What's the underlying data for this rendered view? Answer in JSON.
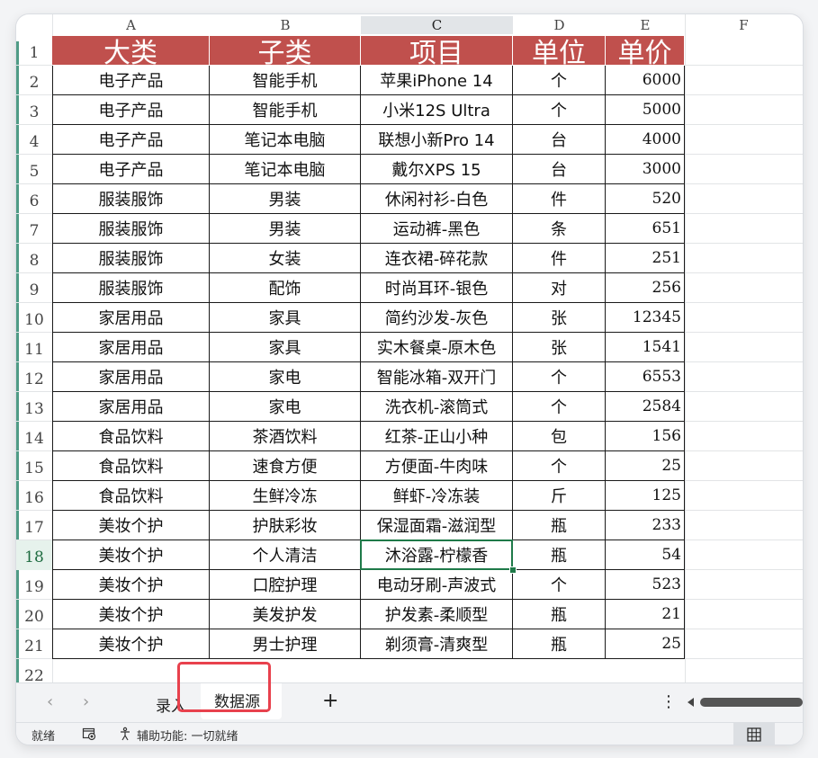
{
  "columns": [
    "A",
    "B",
    "C",
    "D",
    "E",
    "F"
  ],
  "row_numbers": [
    "1",
    "2",
    "3",
    "4",
    "5",
    "6",
    "7",
    "8",
    "9",
    "10",
    "11",
    "12",
    "13",
    "14",
    "15",
    "16",
    "17",
    "18",
    "19",
    "20",
    "21",
    "22"
  ],
  "header": [
    "大类",
    "子类",
    "项目",
    "单位",
    "单价"
  ],
  "rows": [
    [
      "电子产品",
      "智能手机",
      "苹果iPhone 14",
      "个",
      "6000"
    ],
    [
      "电子产品",
      "智能手机",
      "小米12S Ultra",
      "个",
      "5000"
    ],
    [
      "电子产品",
      "笔记本电脑",
      "联想小新Pro 14",
      "台",
      "4000"
    ],
    [
      "电子产品",
      "笔记本电脑",
      "戴尔XPS 15",
      "台",
      "3000"
    ],
    [
      "服装服饰",
      "男装",
      "休闲衬衫-白色",
      "件",
      "520"
    ],
    [
      "服装服饰",
      "男装",
      "运动裤-黑色",
      "条",
      "651"
    ],
    [
      "服装服饰",
      "女装",
      "连衣裙-碎花款",
      "件",
      "251"
    ],
    [
      "服装服饰",
      "配饰",
      "时尚耳环-银色",
      "对",
      "256"
    ],
    [
      "家居用品",
      "家具",
      "简约沙发-灰色",
      "张",
      "12345"
    ],
    [
      "家居用品",
      "家具",
      "实木餐桌-原木色",
      "张",
      "1541"
    ],
    [
      "家居用品",
      "家电",
      "智能冰箱-双开门",
      "个",
      "6553"
    ],
    [
      "家居用品",
      "家电",
      "洗衣机-滚筒式",
      "个",
      "2584"
    ],
    [
      "食品饮料",
      "茶酒饮料",
      "红茶-正山小种",
      "包",
      "156"
    ],
    [
      "食品饮料",
      "速食方便",
      "方便面-牛肉味",
      "个",
      "25"
    ],
    [
      "食品饮料",
      "生鲜冷冻",
      "鲜虾-冷冻装",
      "斤",
      "125"
    ],
    [
      "美妆个护",
      "护肤彩妆",
      "保湿面霜-滋润型",
      "瓶",
      "233"
    ],
    [
      "美妆个护",
      "个人清洁",
      "沐浴露-柠檬香",
      "瓶",
      "54"
    ],
    [
      "美妆个护",
      "口腔护理",
      "电动牙刷-声波式",
      "个",
      "523"
    ],
    [
      "美妆个护",
      "美发护发",
      "护发素-柔顺型",
      "瓶",
      "21"
    ],
    [
      "美妆个护",
      "男士护理",
      "剃须膏-清爽型",
      "瓶",
      "25"
    ]
  ],
  "tabs": {
    "prev": "‹",
    "next": "›",
    "tab1": "录入",
    "tab2": "数据源",
    "add": "+",
    "more": "⋮"
  },
  "status": {
    "ready": "就绪",
    "accessibility": "辅助功能: 一切就绪",
    "macro_icon": "macro-record-icon",
    "access_icon": "accessibility-icon"
  },
  "colors": {
    "header_bg": "#c0504d",
    "active": "#1f7a49",
    "highlight": "#e8414d"
  },
  "selection": {
    "row": "18",
    "column": "C"
  }
}
